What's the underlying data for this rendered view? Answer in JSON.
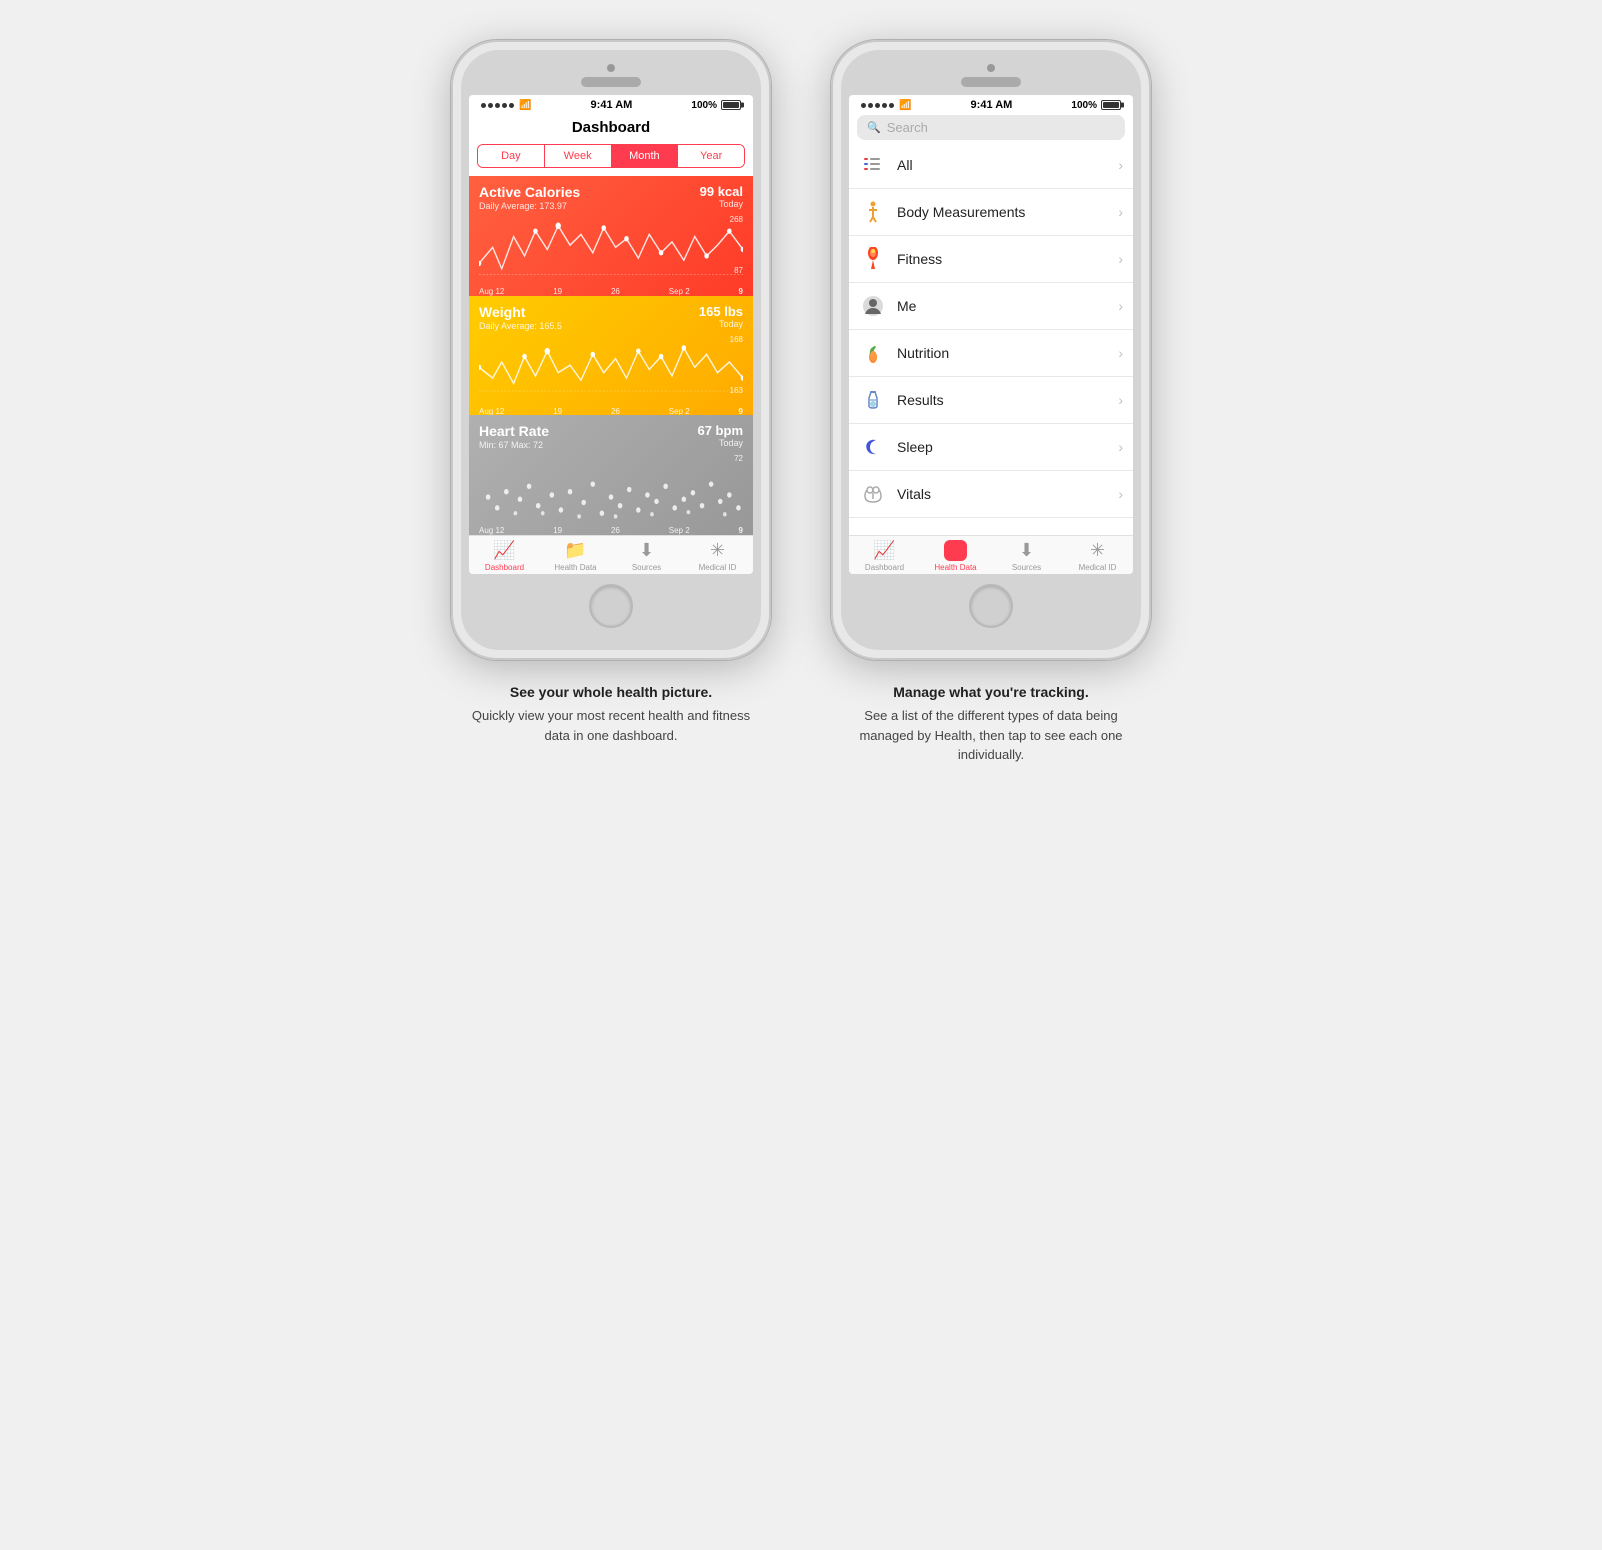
{
  "phone1": {
    "statusBar": {
      "time": "9:41 AM",
      "battery": "100%"
    },
    "title": "Dashboard",
    "segments": [
      "Day",
      "Week",
      "Month",
      "Year"
    ],
    "activeSegment": 2,
    "cards": [
      {
        "id": "calories",
        "title": "Active Calories",
        "value": "99 kcal",
        "subtitle": "Daily Average: 173.97",
        "timeLabel": "Today",
        "maxVal": "268",
        "minVal": "87",
        "dateLabels": [
          "Aug 12",
          "19",
          "26",
          "Sep 2",
          "9"
        ],
        "color": "calories"
      },
      {
        "id": "weight",
        "title": "Weight",
        "value": "165 lbs",
        "subtitle": "Daily Average: 165.5",
        "timeLabel": "Today",
        "maxVal": "168",
        "minVal": "163",
        "dateLabels": [
          "Aug 12",
          "19",
          "26",
          "Sep 2",
          "9"
        ],
        "color": "weight"
      },
      {
        "id": "heartrate",
        "title": "Heart Rate",
        "value": "67 bpm",
        "subtitle": "Min: 67  Max: 72",
        "timeLabel": "Today",
        "maxVal": "72",
        "minVal": "",
        "dateLabels": [
          "Aug 12",
          "19",
          "26",
          "Sep 2",
          "9"
        ],
        "color": "heartrate"
      }
    ],
    "tabs": [
      {
        "id": "dashboard",
        "label": "Dashboard",
        "icon": "📈",
        "active": true
      },
      {
        "id": "health-data",
        "label": "Health Data",
        "icon": "📁",
        "active": false
      },
      {
        "id": "sources",
        "label": "Sources",
        "icon": "⬇",
        "active": false
      },
      {
        "id": "medical-id",
        "label": "Medical ID",
        "icon": "✳",
        "active": false
      }
    ]
  },
  "phone2": {
    "statusBar": {
      "time": "9:41 AM",
      "battery": "100%"
    },
    "search": {
      "placeholder": "Search"
    },
    "listItems": [
      {
        "id": "all",
        "label": "All",
        "iconType": "list"
      },
      {
        "id": "body",
        "label": "Body Measurements",
        "iconType": "person"
      },
      {
        "id": "fitness",
        "label": "Fitness",
        "iconType": "fire"
      },
      {
        "id": "me",
        "label": "Me",
        "iconType": "user"
      },
      {
        "id": "nutrition",
        "label": "Nutrition",
        "iconType": "carrot"
      },
      {
        "id": "results",
        "label": "Results",
        "iconType": "flask"
      },
      {
        "id": "sleep",
        "label": "Sleep",
        "iconType": "moon"
      },
      {
        "id": "vitals",
        "label": "Vitals",
        "iconType": "stethoscope"
      }
    ],
    "tabs": [
      {
        "id": "dashboard",
        "label": "Dashboard",
        "icon": "📈",
        "active": false
      },
      {
        "id": "health-data",
        "label": "Health Data",
        "icon": "❤",
        "active": true
      },
      {
        "id": "sources",
        "label": "Sources",
        "icon": "⬇",
        "active": false
      },
      {
        "id": "medical-id",
        "label": "Medical ID",
        "icon": "✳",
        "active": false
      }
    ]
  },
  "captions": {
    "left": {
      "title": "See your whole health picture.",
      "body": "Quickly view your most recent health and fitness data in one dashboard."
    },
    "right": {
      "title": "Manage what you're tracking.",
      "body": "See a list of the different types of data being managed by Health, then tap to see each one individually."
    }
  }
}
